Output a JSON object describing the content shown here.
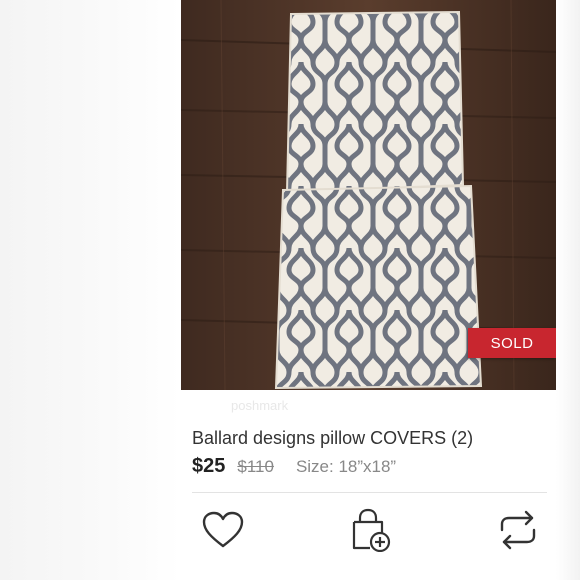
{
  "listing": {
    "sold_label": "SOLD",
    "title": "Ballard designs pillow COVERS (2)",
    "price": "$25",
    "original_price": "$110",
    "size": "Size: 18”x18”",
    "watermark": "poshmark"
  },
  "actions": {
    "like_icon": "heart-icon",
    "bundle_icon": "shopping-bag-plus-icon",
    "share_icon": "share-arrows-icon"
  },
  "colors": {
    "sold_badge": "#c8262f",
    "floor": "#4a3226",
    "pattern": "#6f7480",
    "fabric": "#f1ece3"
  }
}
